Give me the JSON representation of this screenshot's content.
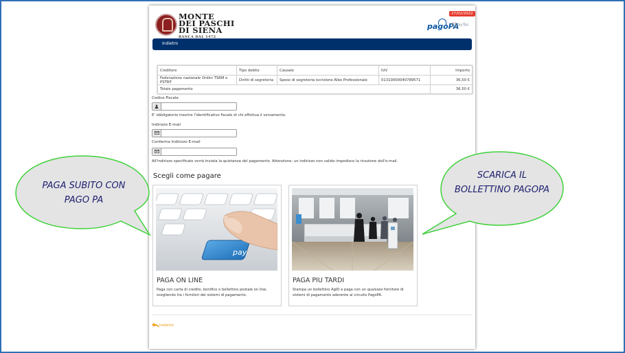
{
  "header": {
    "bank_name_line1": "MONTE",
    "bank_name_line2": "DEI PASCHI",
    "bank_name_line3": "DI SIENA",
    "bank_sub": "BANCA DAL 1472",
    "date_badge": "27/02/2022",
    "pagopa_logo": "pagoPA",
    "paytas_alt": "PayTas"
  },
  "nav": {
    "back_label": "Indietro"
  },
  "table": {
    "headers": [
      "Creditore",
      "Tipo debito",
      "Causale",
      "IUV",
      "Importo"
    ],
    "rows": [
      [
        "Federazione nazionale Ordini TSRM e PSTRP",
        "Diritti di segreteria",
        "Spese di segreteria iscrizione Albo Professionale",
        "01310000040789571",
        "36,50 €"
      ]
    ],
    "total_label": "Totale pagamento",
    "total_value": "36,50 €"
  },
  "form": {
    "cf_label": "Codice Fiscale",
    "cf_value": "",
    "cf_hint": "E' obbligatorio inserire l'identificativo fiscale di chi effettua il versamento.",
    "email_label": "Indirizzo E-mail",
    "email_value": "",
    "confirm_label": "Conferma Indirizzo E-mail",
    "confirm_value": "",
    "email_hint": "All'indirizzo specificato verrà inviata la quietanza del pagamento. Attenzione: un indirizzo non valido impedisce la ricezione dell'e-mail.",
    "user_icon": "user-icon",
    "mail_icon": "envelope-icon"
  },
  "payment": {
    "heading": "Scegli come pagare",
    "online": {
      "title": "PAGA ON LINE",
      "desc": "Paga con carta di credito, bonifico o bollettino postale on line, scegliendo tra i fornitori dei sistemi di pagamento.",
      "key_label": "pay",
      "icon": "keyboard-pay-image"
    },
    "later": {
      "title": "PAGA PIU TARDI",
      "desc": "Stampa un bollettino AgID e paga con un qualsiasi fornitore di sistemi di pagamento aderente al circuito PagoPA.",
      "icon": "bank-counter-image"
    }
  },
  "footer": {
    "back_label": "Indietro",
    "icon": "back-arrow-icon"
  },
  "annotations": {
    "left_line1": "PAGA SUBITO CON",
    "left_line2": "PAGO PA",
    "right_line1": "SCARICA IL",
    "right_line2": "BOLLETTINO PAGOPA"
  },
  "colors": {
    "navbar": "#00306c",
    "accent_orange": "#f39a16",
    "badge_red": "#e63b2e",
    "bubble_border": "#3fd13a",
    "bubble_text": "#1c1f6e",
    "pagopa_blue": "#0b57a4"
  }
}
